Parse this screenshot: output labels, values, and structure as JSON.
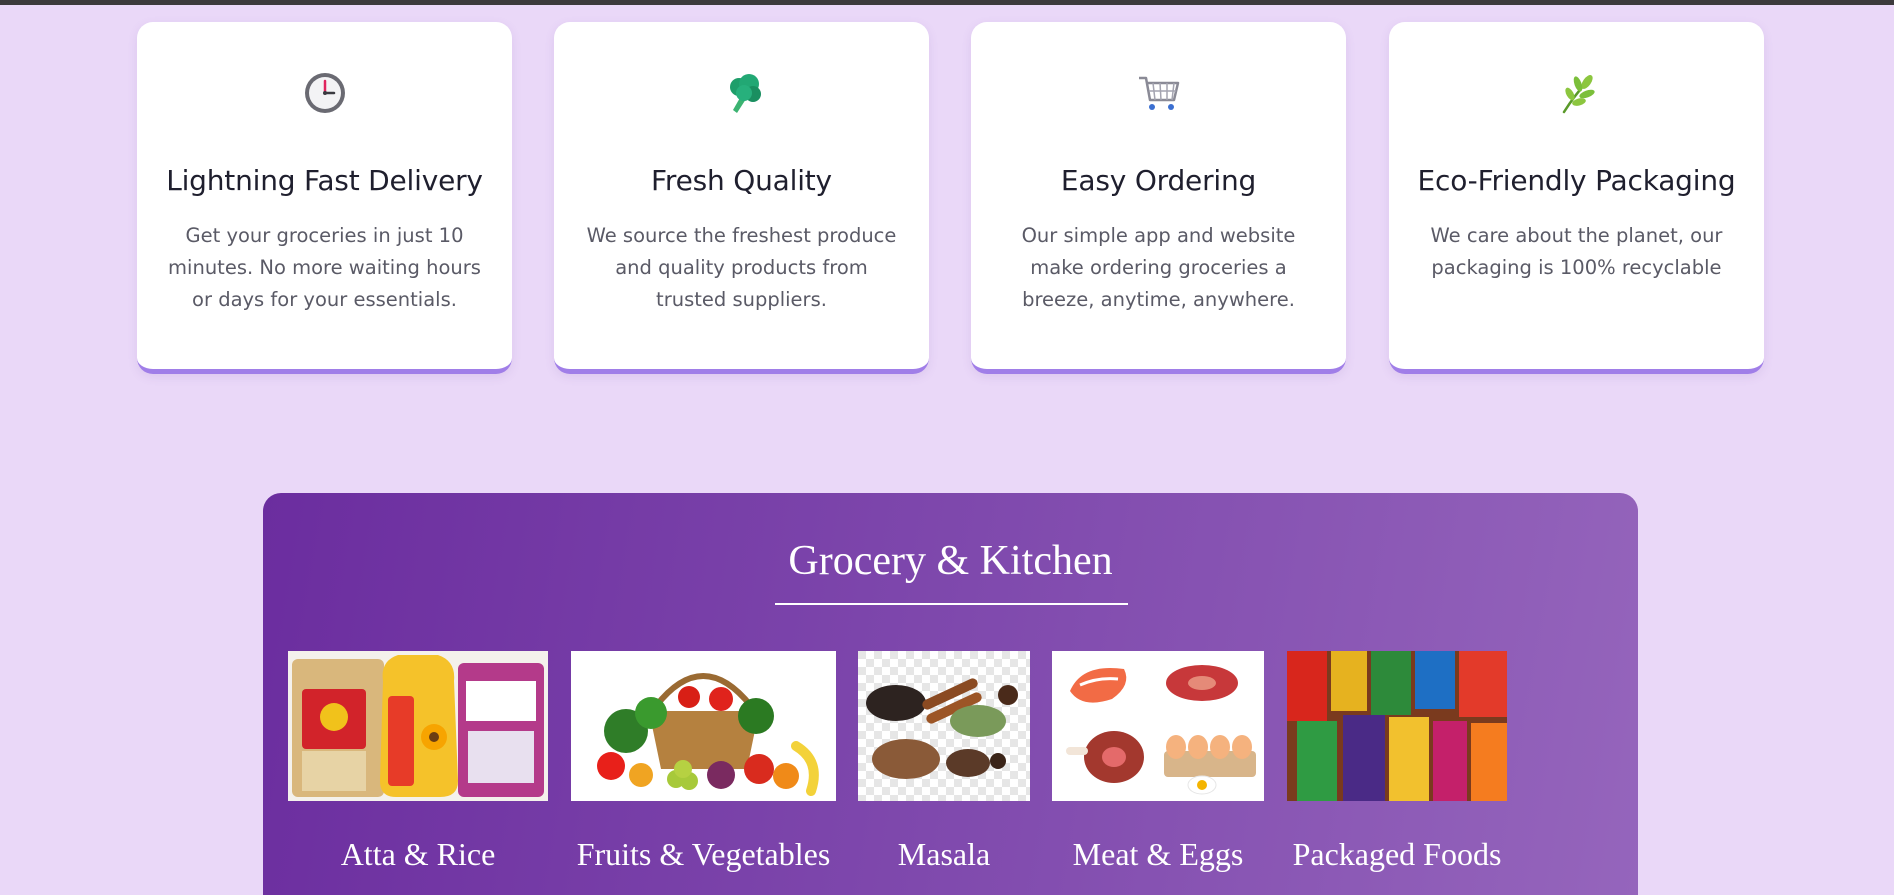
{
  "features": [
    {
      "icon": "clock-icon",
      "title": "Lightning Fast Delivery",
      "desc": "Get your groceries in just 10 minutes. No more waiting hours or days for your essentials."
    },
    {
      "icon": "broccoli-icon",
      "title": "Fresh Quality",
      "desc": "We source the freshest produce and quality products from trusted suppliers."
    },
    {
      "icon": "shopping-cart-icon",
      "title": "Easy Ordering",
      "desc": "Our simple app and website make ordering groceries a breeze, anytime, anywhere."
    },
    {
      "icon": "leaf-icon",
      "title": "Eco-Friendly Packaging",
      "desc": "We care about the planet, our packaging is 100% recyclable"
    }
  ],
  "grocery": {
    "title": "Grocery & Kitchen",
    "categories": [
      {
        "label": "Atta & Rice",
        "image": "atta-rice-image"
      },
      {
        "label": "Fruits & Vegetables",
        "image": "fruits-vegetables-image"
      },
      {
        "label": "Masala",
        "image": "masala-image"
      },
      {
        "label": "Meat & Eggs",
        "image": "meat-eggs-image"
      },
      {
        "label": "Packaged Foods",
        "image": "packaged-foods-image"
      }
    ]
  },
  "colors": {
    "page_background": "#ead8f8",
    "card_accent": "#a07ee8",
    "section_gradient_start": "#6b2d9f",
    "section_gradient_end": "#9565bc"
  }
}
